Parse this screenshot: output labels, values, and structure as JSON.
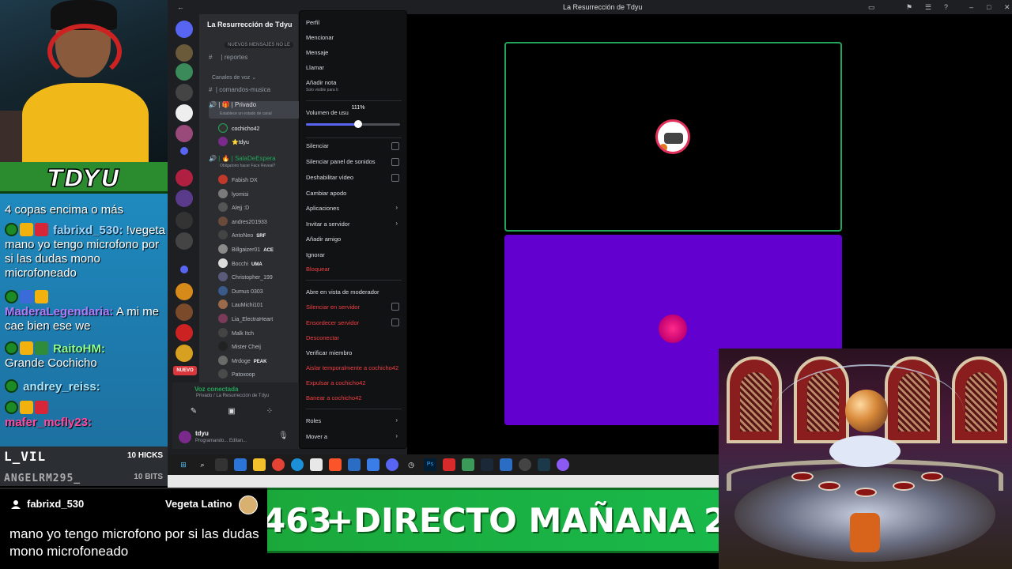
{
  "window": {
    "title": "La Resurrección de Tdyu"
  },
  "overlay": {
    "logo": "TDYU",
    "chat": [
      {
        "text": "4 copas encima o más"
      },
      {
        "user": "fabrixd_530:",
        "color": "#9fd6ff",
        "message": "!vegeta mano yo tengo microfono por si las dudas mono microfoneado"
      },
      {
        "user": "MaderaLegendaria:",
        "color": "#b07cff",
        "message": "A mi me cae bien ese we"
      },
      {
        "user": "RaitoHM:",
        "color": "#8dff8d",
        "message": "Grande Cochicho"
      },
      {
        "user": "andrey_reiss:",
        "color": "#a9e7ff",
        "message": ""
      },
      {
        "user": "mafer_mcfly23:",
        "color": "#ff4aa0",
        "message": ""
      }
    ],
    "subs": [
      {
        "name": "L_VIL",
        "count": "10 HICKS"
      },
      {
        "name": "ANGELRM295_",
        "count": "10 BITS"
      }
    ],
    "highlight": {
      "user": "fabrixd_530",
      "channel": "Vegeta Latino",
      "message": "mano yo tengo microfono por si las dudas mono microfoneado"
    },
    "banner": {
      "left": "463",
      "main": "+DIRECTO MAÑANA",
      "right": "2"
    }
  },
  "discord": {
    "server_name": "La Resurrección de Tdyu",
    "new_messages": "NUEVOS MENSAJES NO LE",
    "channels": {
      "reportes": "reportes",
      "voice_category": "Canales de voz",
      "music": "comandos-musica",
      "privado": "Privado",
      "privado_status": "Establece un estado de canal",
      "sala": "SalaDeEspera",
      "sala_status": "Obligatorio hacer Face Reveal?"
    },
    "privado_members": [
      "cochicho42",
      "tdyu"
    ],
    "sala_members": [
      {
        "name": "Fabish DX",
        "tag": ""
      },
      {
        "name": "lyomisi",
        "tag": ""
      },
      {
        "name": "Alejj :D",
        "tag": ""
      },
      {
        "name": "andres201933",
        "tag": ""
      },
      {
        "name": "AntoNeo",
        "tag": "SRF"
      },
      {
        "name": "Billgaizer01",
        "tag": "ACE"
      },
      {
        "name": "Bocchi",
        "tag": "UMA"
      },
      {
        "name": "Christopher_199",
        "tag": ""
      },
      {
        "name": "Dumus 0303",
        "tag": ""
      },
      {
        "name": "LauMichi101",
        "tag": ""
      },
      {
        "name": "Lia_ElectraHeart",
        "tag": ""
      },
      {
        "name": "Malk Itch",
        "tag": ""
      },
      {
        "name": "Mister Cheij",
        "tag": ""
      },
      {
        "name": "Mrdoge",
        "tag": "PEAK"
      },
      {
        "name": "Patoxoop",
        "tag": ""
      }
    ],
    "nuevo": "NUEVO",
    "voice_panel": {
      "status": "Voz conectada",
      "sub": "Privado / La Resurrección de Tdyu"
    },
    "user_panel": {
      "name": "tdyu",
      "status": "Programando... Editan..."
    },
    "context_menu": {
      "perfil": "Perfil",
      "mencionar": "Mencionar",
      "mensaje": "Mensaje",
      "llamar": "Llamar",
      "anadir_nota": "Añadir nota",
      "nota_sub": "Solo visible para ti",
      "volumen": "Volumen de usu",
      "volume_value": 111,
      "volume_tip": "111%",
      "silenciar": "Silenciar",
      "silenciar_panel": "Silenciar panel de sonidos",
      "deshabilitar_video": "Deshabilitar vídeo",
      "cambiar_apodo": "Cambiar apodo",
      "aplicaciones": "Aplicaciones",
      "invitar": "Invitar a servidor",
      "anadir_amigo": "Añadir amigo",
      "ignorar": "Ignorar",
      "bloquear": "Bloquear",
      "vista_moderador": "Abre en vista de moderador",
      "silenciar_servidor": "Silenciar en servidor",
      "ensordecer": "Ensordecer servidor",
      "desconectar": "Desconectar",
      "verificar": "Verificar miembro",
      "aislar": "Aislar temporalmente a cochicho42",
      "expulsar": "Expulsar a cochicho42",
      "banear": "Banear a cochicho42",
      "roles": "Roles",
      "mover": "Mover a"
    }
  },
  "colors": {
    "discord_bg": "#1e1f22",
    "sidebar": "#2b2d31",
    "accent": "#5865f2",
    "danger": "#f23f42",
    "speaking": "#23a559",
    "tile_purple": "#6200cf"
  }
}
